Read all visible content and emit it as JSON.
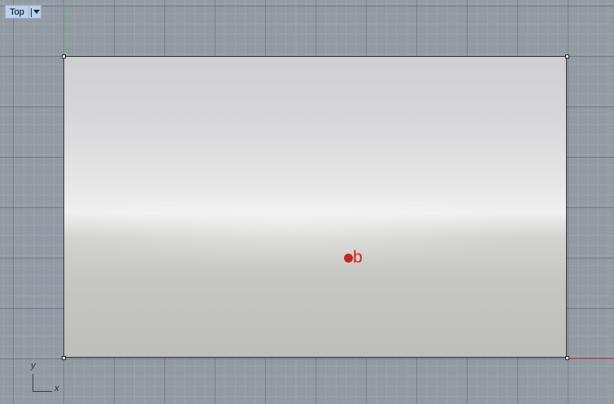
{
  "viewport": {
    "title": "Top",
    "menu_icon": "dropdown-arrow-icon"
  },
  "scene": {
    "point_label": "b",
    "point_color": "#c4232a",
    "surface_color": "#d8d8da",
    "grid_background": "#929aa4",
    "x_axis_color": "#c04a4a",
    "y_axis_color": "#3fae3f"
  },
  "axis_widget": {
    "x_label": "x",
    "y_label": "y"
  }
}
